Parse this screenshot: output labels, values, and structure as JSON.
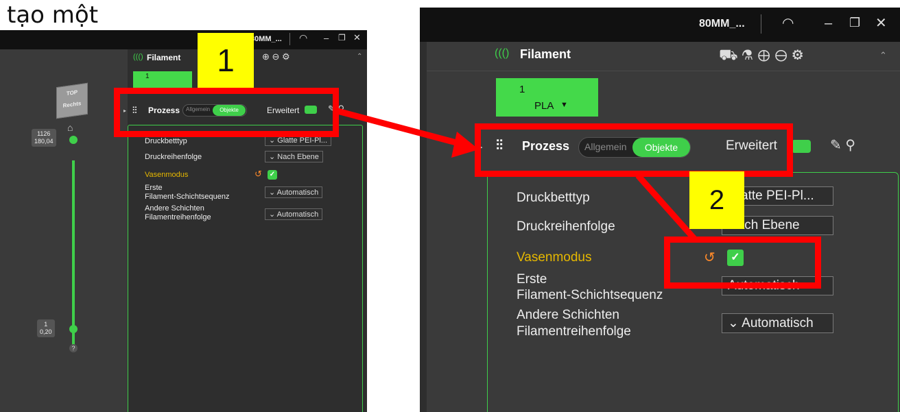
{
  "caption": "tạo một",
  "window": {
    "title": "80MM_...",
    "title_left": "80MM_...",
    "controls": [
      "–",
      "❐",
      "✕"
    ]
  },
  "left": {
    "cube_label_top": "TOP",
    "cube_label_front": "Rechts",
    "layer_top": {
      "num": "1126",
      "height": "180,04"
    },
    "layer_bottom": {
      "num": "1",
      "height": "0,20"
    },
    "help": "?",
    "filament_label": "Filament",
    "chip_num": "1",
    "process_label": "Prozess",
    "seg_general": "Allgemein",
    "seg_objects": "Objekte",
    "advanced": "Erweitert",
    "rows": [
      {
        "label": "Druckbetttyp",
        "value": "Glatte PEI-Pl..."
      },
      {
        "label": "Druckreihenfolge",
        "value": "Nach Ebene"
      },
      {
        "label": "Vasenmodus",
        "value": ""
      },
      {
        "label": "Erste\nFilament-Schichtsequenz",
        "value": "Automatisch"
      },
      {
        "label": "Andere Schichten\nFilamentreihenfolge",
        "value": "Automatisch"
      }
    ]
  },
  "right": {
    "filament_label": "Filament",
    "chip_num": "1",
    "chip_material": "PLA",
    "process_label": "Prozess",
    "seg_general": "Allgemein",
    "seg_objects": "Objekte",
    "advanced": "Erweitert",
    "rows": [
      {
        "label": "Druckbetttyp",
        "value": "Glatte PEI-Pl..."
      },
      {
        "label": "Druckreihenfolge",
        "value": "Nach Ebene"
      },
      {
        "label": "Vasenmodus",
        "value": ""
      },
      {
        "label_1": "Erste",
        "label_2": "Filament-Schichtsequenz",
        "value": "Automatisch"
      },
      {
        "label_1": "Andere Schichten",
        "label_2": "Filamentreihenfolge",
        "value": "Automatisch"
      }
    ]
  },
  "annotations": {
    "step1": "1",
    "step2": "2"
  },
  "colors": {
    "accent_green": "#44d94a",
    "highlight_red": "#ff0000",
    "label_yellow": "#ffff00",
    "vase_label": "#e6b800"
  }
}
